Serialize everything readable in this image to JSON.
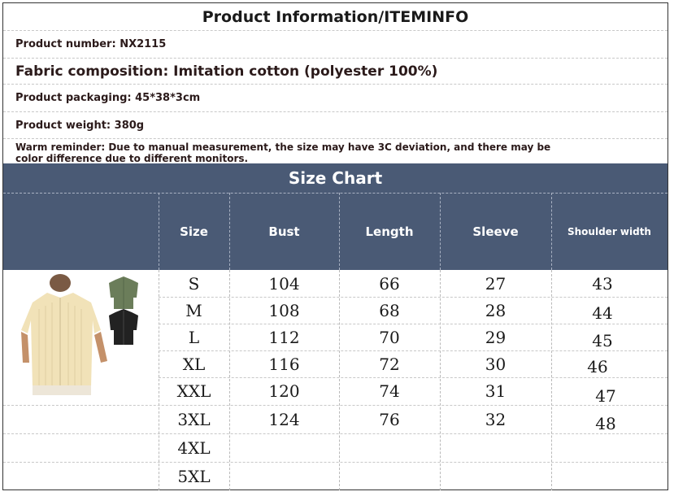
{
  "info": {
    "title": "Product Information/ITEMINFO",
    "product_number": "Product number: NX2115",
    "fabric": "Fabric composition: Imitation cotton (polyester 100%)",
    "packaging": "Product packaging: 45*38*3cm",
    "weight": "Product weight: 380g",
    "reminder": "Warm reminder: Due to manual measurement, the size may have 3C deviation, and there may be color difference due to different monitors."
  },
  "size_chart": {
    "title": "Size Chart",
    "headers": [
      "Size",
      "Bust",
      "Length",
      "Sleeve",
      "Shoulder width"
    ],
    "rows": [
      [
        "S",
        "104",
        "66",
        "27",
        "43"
      ],
      [
        "M",
        "108",
        "68",
        "28",
        "44"
      ],
      [
        "L",
        "112",
        "70",
        "29",
        "45"
      ],
      [
        "XL",
        "116",
        "72",
        "30",
        "46"
      ],
      [
        "XXL",
        "120",
        "74",
        "31",
        "47"
      ],
      [
        "3XL",
        "124",
        "76",
        "32",
        "48"
      ],
      [
        "4XL",
        "",
        "",
        "",
        ""
      ],
      [
        "5XL",
        "",
        "",
        "",
        ""
      ]
    ]
  },
  "colors": {
    "header_band": "#4a5a75",
    "shirt_beige": "#f1e2b8",
    "shirt_green": "#6b7d5a",
    "shirt_black": "#222222"
  }
}
